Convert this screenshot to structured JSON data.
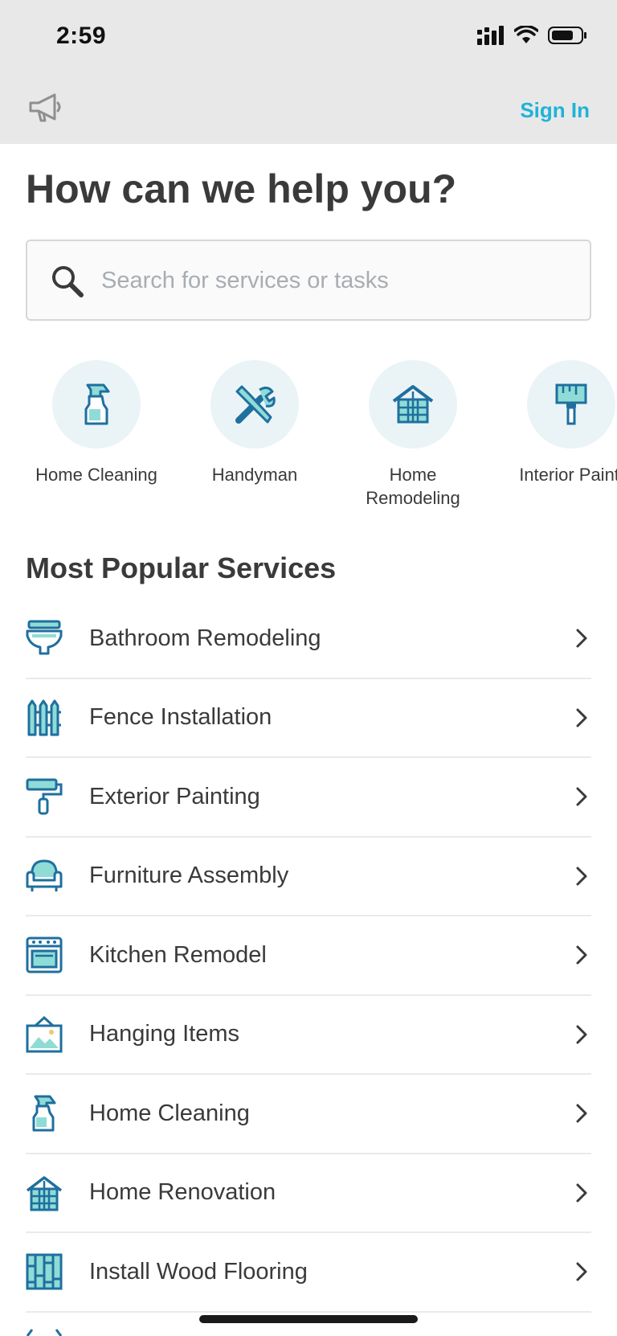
{
  "status": {
    "time": "2:59"
  },
  "header": {
    "sign_in": "Sign In"
  },
  "title": "How can we help you?",
  "search": {
    "placeholder": "Search for services or tasks"
  },
  "categories": [
    {
      "label": "Home Cleaning",
      "icon": "spray-bottle-icon"
    },
    {
      "label": "Handyman",
      "icon": "tools-icon"
    },
    {
      "label": "Home\nRemodeling",
      "icon": "house-icon"
    },
    {
      "label": "Interior Painti",
      "icon": "paintbrush-icon"
    }
  ],
  "section_title": "Most Popular Services",
  "services": [
    {
      "label": "Bathroom Remodeling",
      "icon": "toilet-icon"
    },
    {
      "label": "Fence Installation",
      "icon": "fence-icon"
    },
    {
      "label": "Exterior Painting",
      "icon": "paint-roller-icon"
    },
    {
      "label": "Furniture Assembly",
      "icon": "armchair-icon"
    },
    {
      "label": "Kitchen Remodel",
      "icon": "oven-icon"
    },
    {
      "label": "Hanging Items",
      "icon": "picture-frame-icon"
    },
    {
      "label": "Home Cleaning",
      "icon": "spray-bottle-icon"
    },
    {
      "label": "Home Renovation",
      "icon": "house-icon"
    },
    {
      "label": "Install Wood Flooring",
      "icon": "wood-floor-icon"
    }
  ],
  "colors": {
    "accent": "#1fb3d6",
    "icon_blue": "#1f6f9f",
    "icon_teal": "#8fdcd6",
    "header_bg": "#e8e8e8"
  }
}
